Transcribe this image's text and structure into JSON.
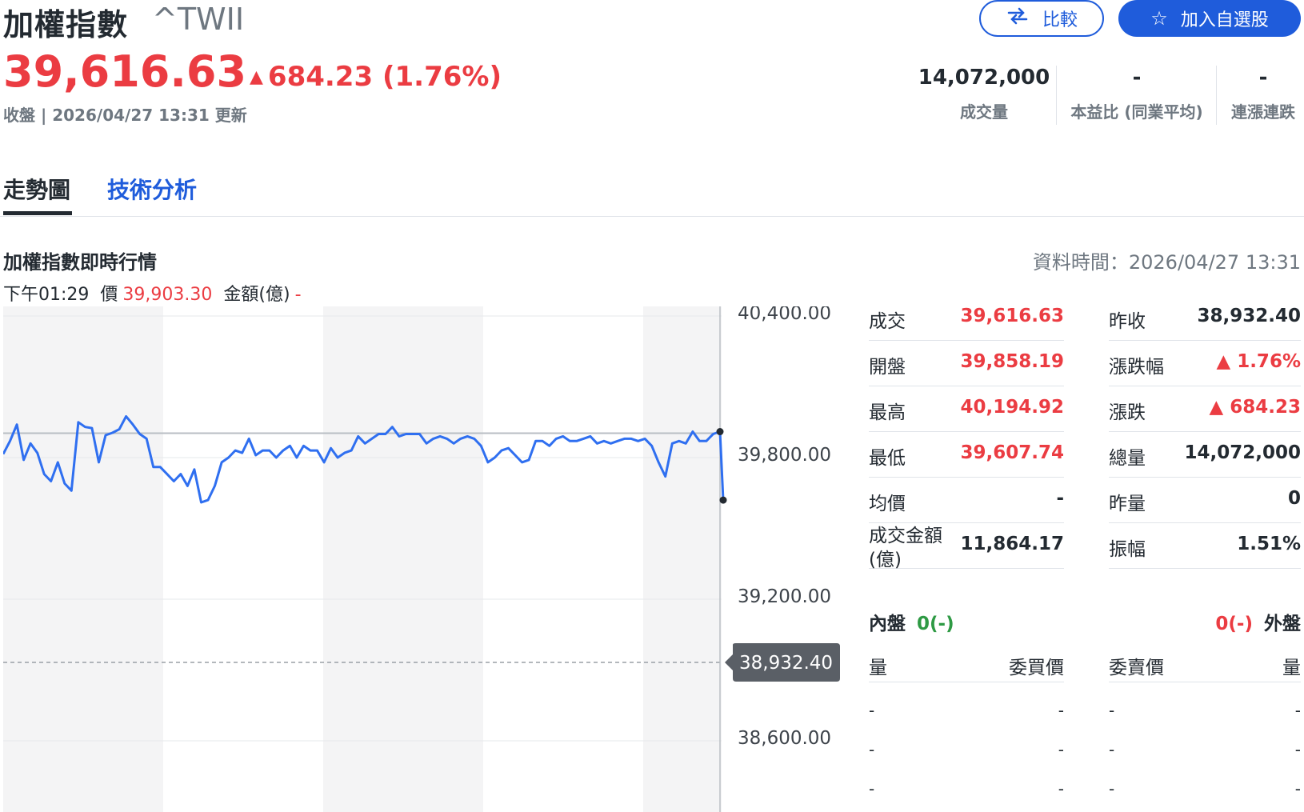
{
  "header": {
    "title": "加權指數",
    "symbol": "^TWII",
    "price": "39,616.63",
    "change": "684.23 (1.76%)",
    "change_arrow": "▲",
    "status": "收盤 | 2026/04/27 13:31 更新",
    "compare_label": "比較",
    "compare_icon": "swap-icon",
    "favorite_label": "加入自選股",
    "favorite_icon": "star-icon"
  },
  "stats": [
    {
      "value": "14,072,000",
      "label": "成交量"
    },
    {
      "value": "-",
      "label": "本益比 (同業平均)"
    },
    {
      "value": "-",
      "label": "連漲連跌"
    }
  ],
  "tabs": [
    {
      "label": "走勢圖",
      "active": true
    },
    {
      "label": "技術分析",
      "active": false
    }
  ],
  "section": {
    "title": "加權指數即時行情",
    "data_time": "資料時間：2026/04/27 13:31"
  },
  "hover": {
    "time": "下午01:29",
    "price_label": "價",
    "price_value": "39,903.30",
    "amount_label": "金額(億)",
    "amount_value": "-"
  },
  "colors": {
    "up": "#eb3c42",
    "down": "#2e9a44",
    "accent": "#1f5cdb",
    "line": "#2f6ff0"
  },
  "chart_data": {
    "type": "line",
    "y_ticks": [
      "40,400.00",
      "39,800.00",
      "39,200.00",
      "38,600.00"
    ],
    "ylim": [
      38300,
      40430
    ],
    "prev_close": 38932.4,
    "prev_close_label": "38,932.40",
    "reference_line": 39903.3,
    "series": [
      {
        "values": [
          39815,
          39870,
          39940,
          39790,
          39860,
          39820,
          39730,
          39700,
          39780,
          39690,
          39660,
          39950,
          39930,
          39925,
          39780,
          39895,
          39905,
          39920,
          39975,
          39940,
          39900,
          39880,
          39760,
          39760,
          39730,
          39700,
          39730,
          39680,
          39750,
          39610,
          39620,
          39680,
          39780,
          39800,
          39830,
          39820,
          39880,
          39810,
          39830,
          39830,
          39800,
          39830,
          39850,
          39800,
          39850,
          39830,
          39830,
          39780,
          39840,
          39800,
          39820,
          39830,
          39890,
          39860,
          39880,
          39900,
          39900,
          39930,
          39890,
          39900,
          39900,
          39900,
          39860,
          39880,
          39890,
          39880,
          39860,
          39880,
          39890,
          39880,
          39850,
          39780,
          39800,
          39830,
          39840,
          39810,
          39780,
          39790,
          39870,
          39870,
          39850,
          39880,
          39890,
          39870,
          39870,
          39880,
          39890,
          39860,
          39870,
          39860,
          39870,
          39880,
          39880,
          39870,
          39880,
          39850,
          39780,
          39720,
          39860,
          39870,
          39860,
          39910,
          39870,
          39870,
          39900,
          39910,
          39620
        ]
      }
    ]
  },
  "quote_left": [
    {
      "label": "成交",
      "value": "39,616.63",
      "color": "red"
    },
    {
      "label": "開盤",
      "value": "39,858.19",
      "color": "red"
    },
    {
      "label": "最高",
      "value": "40,194.92",
      "color": "red"
    },
    {
      "label": "最低",
      "value": "39,607.74",
      "color": "red"
    },
    {
      "label": "均價",
      "value": "-",
      "color": "black"
    },
    {
      "label": "成交金額(億)",
      "value": "11,864.17",
      "color": "black"
    }
  ],
  "quote_right": [
    {
      "label": "昨收",
      "value": "38,932.40",
      "color": "black"
    },
    {
      "label": "漲跌幅",
      "value": "▲ 1.76%",
      "color": "red"
    },
    {
      "label": "漲跌",
      "value": "▲ 684.23",
      "color": "red"
    },
    {
      "label": "總量",
      "value": "14,072,000",
      "color": "black"
    },
    {
      "label": "昨量",
      "value": "0",
      "color": "black"
    },
    {
      "label": "振幅",
      "value": "1.51%",
      "color": "black"
    }
  ],
  "orderbook": {
    "inner_label": "內盤",
    "inner_value": "0(-)",
    "outer_label": "外盤",
    "outer_value": "0(-)",
    "headers": [
      "量",
      "委買價",
      "委賣價",
      "量"
    ],
    "rows": [
      [
        "-",
        "-",
        "-",
        "-"
      ],
      [
        "-",
        "-",
        "-",
        "-"
      ],
      [
        "-",
        "-",
        "-",
        "-"
      ]
    ]
  }
}
